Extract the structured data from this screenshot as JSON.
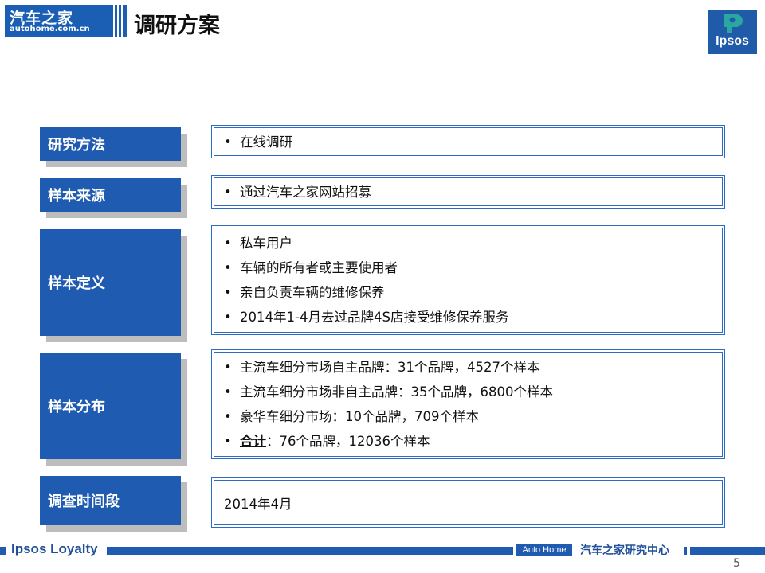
{
  "header": {
    "logo_cn": "汽车之家",
    "logo_en": "autohome.com.cn",
    "title": "调研方案",
    "ipsos_logo": "Ipsos"
  },
  "rows": [
    {
      "label": "研究方法",
      "items": [
        "在线调研"
      ]
    },
    {
      "label": "样本来源",
      "items": [
        "通过汽车之家网站招募"
      ]
    },
    {
      "label": "样本定义",
      "items": [
        "私车用户",
        "车辆的所有者或主要使用者",
        "亲自负责车辆的维修保养",
        "2014年1-4月去过品牌4S店接受维修保养服务"
      ]
    },
    {
      "label": "样本分布",
      "items": [
        "主流车细分市场自主品牌：31个品牌，4527个样本",
        "主流车细分市场非自主品牌：35个品牌，6800个样本",
        "豪华车细分市场：10个品牌，709个样本"
      ],
      "total_label": "合计",
      "total_value": "：76个品牌，12036个样本"
    },
    {
      "label": "调查时间段",
      "value": "2014年4月"
    }
  ],
  "footer": {
    "left": "Ipsos Loyalty",
    "autohome_en": "Auto Home",
    "center_cn": "汽车之家研究中心"
  },
  "page_number": "5",
  "colors": {
    "brand_blue": "#1f5bb0",
    "shadow_gray": "#bdbdbd",
    "border_blue": "#2a6cc4"
  }
}
